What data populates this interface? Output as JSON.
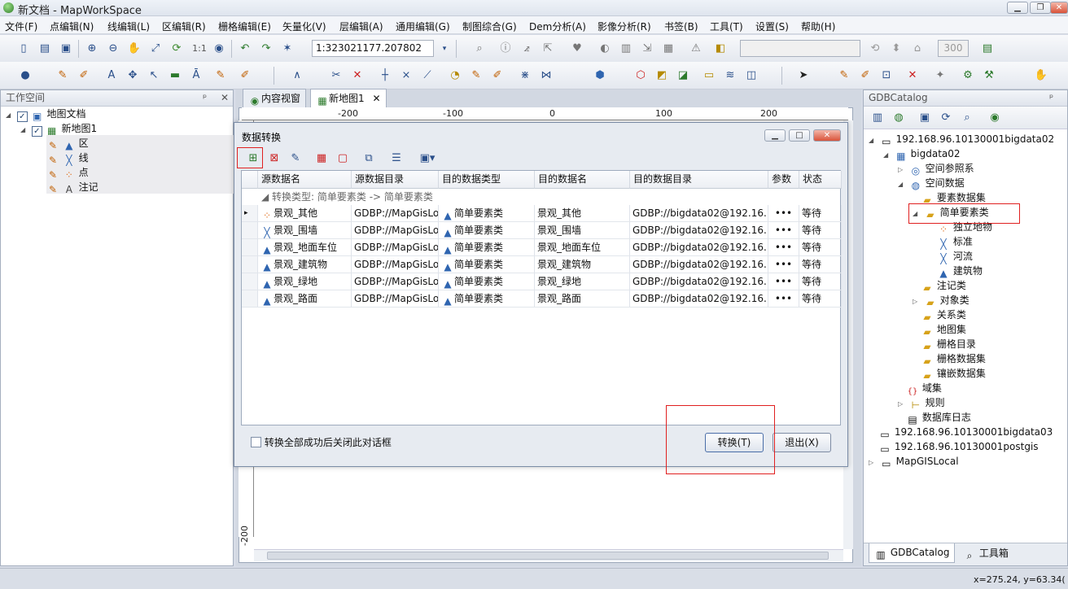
{
  "window": {
    "title": "新文档 - MapWorkSpace",
    "min": "▁",
    "restore": "❐",
    "close": "✕"
  },
  "menu": [
    "文件(F)",
    "点编辑(N)",
    "线编辑(L)",
    "区编辑(R)",
    "栅格编辑(E)",
    "矢量化(V)",
    "层编辑(A)",
    "通用编辑(G)",
    "制图综合(G)",
    "Dem分析(A)",
    "影像分析(R)",
    "书签(B)",
    "工具(T)",
    "设置(S)",
    "帮助(H)"
  ],
  "toolbar": {
    "scale_value": "1:323021177.207802",
    "ratio_label": "1:1",
    "layer_combo": "",
    "num_value": "300"
  },
  "workspace": {
    "title": "工作空间",
    "pin": "ᵖ",
    "close": "✕",
    "tree": {
      "doc": "地图文档",
      "map": "新地图1",
      "layers": [
        "区",
        "线",
        "点",
        "注记"
      ]
    }
  },
  "tabs": {
    "content_view": "内容视窗",
    "map_tab": "新地图1",
    "map_tab_close": "✕"
  },
  "ruler": {
    "top": [
      "-200",
      "-100",
      "0",
      "100",
      "200"
    ],
    "left": "-200"
  },
  "dialog": {
    "title": "数据转换",
    "group_label": "转换类型: 简单要素类 -> 简单要素类",
    "columns": [
      "源数据名",
      "源数据目录",
      "目的数据类型",
      "目的数据名",
      "目的数据目录",
      "参数",
      "状态"
    ],
    "rows": [
      {
        "src_name": "景观_其他",
        "src_dir": "GDBP://MapGisLoca",
        "dst_type": "简单要素类",
        "dst_name": "景观_其他",
        "dst_dir": "GDBP://bigdata02@192.16...",
        "param": "•••",
        "status": "等待",
        "icon": "point"
      },
      {
        "src_name": "景观_围墙",
        "src_dir": "GDBP://MapGisLoca",
        "dst_type": "简单要素类",
        "dst_name": "景观_围墙",
        "dst_dir": "GDBP://bigdata02@192.16...",
        "param": "•••",
        "status": "等待",
        "icon": "line"
      },
      {
        "src_name": "景观_地面车位",
        "src_dir": "GDBP://MapGisLoca",
        "dst_type": "简单要素类",
        "dst_name": "景观_地面车位",
        "dst_dir": "GDBP://bigdata02@192.16...",
        "param": "•••",
        "status": "等待",
        "icon": "area"
      },
      {
        "src_name": "景观_建筑物",
        "src_dir": "GDBP://MapGisLoca",
        "dst_type": "简单要素类",
        "dst_name": "景观_建筑物",
        "dst_dir": "GDBP://bigdata02@192.16...",
        "param": "•••",
        "status": "等待",
        "icon": "area"
      },
      {
        "src_name": "景观_绿地",
        "src_dir": "GDBP://MapGisLoca",
        "dst_type": "简单要素类",
        "dst_name": "景观_绿地",
        "dst_dir": "GDBP://bigdata02@192.16...",
        "param": "•••",
        "status": "等待",
        "icon": "area"
      },
      {
        "src_name": "景观_路面",
        "src_dir": "GDBP://MapGisLoca",
        "dst_type": "简单要素类",
        "dst_name": "景观_路面",
        "dst_dir": "GDBP://bigdata02@192.16...",
        "param": "•••",
        "status": "等待",
        "icon": "area"
      }
    ],
    "close_after": "转换全部成功后关闭此对话框",
    "convert_btn": "转换(T)",
    "exit_btn": "退出(X)"
  },
  "catalog": {
    "title": "GDBCatalog",
    "nodes": {
      "server1": "192.168.96.10130001bigdata02",
      "db": "bigdata02",
      "spatial_ref": "空间参照系",
      "spatial_data": "空间数据",
      "feature_ds": "要素数据集",
      "simple_fc": "简单要素类",
      "fc_items": [
        "独立地物",
        "标准",
        "河流",
        "建筑物"
      ],
      "annotation": "注记类",
      "object": "对象类",
      "relation": "关系类",
      "mapset": "地图集",
      "raster_cat": "栅格目录",
      "raster_ds": "栅格数据集",
      "mosaic_ds": "镶嵌数据集",
      "domain": "域集",
      "rules": "规则",
      "db_log": "数据库日志",
      "server2": "192.168.96.10130001bigdata03",
      "server3": "192.168.96.10130001postgis",
      "local": "MapGISLocal"
    },
    "bottom_tabs": [
      "GDBCatalog",
      "工具箱"
    ]
  },
  "status": {
    "coords": "x=275.24, y=63.34("
  }
}
